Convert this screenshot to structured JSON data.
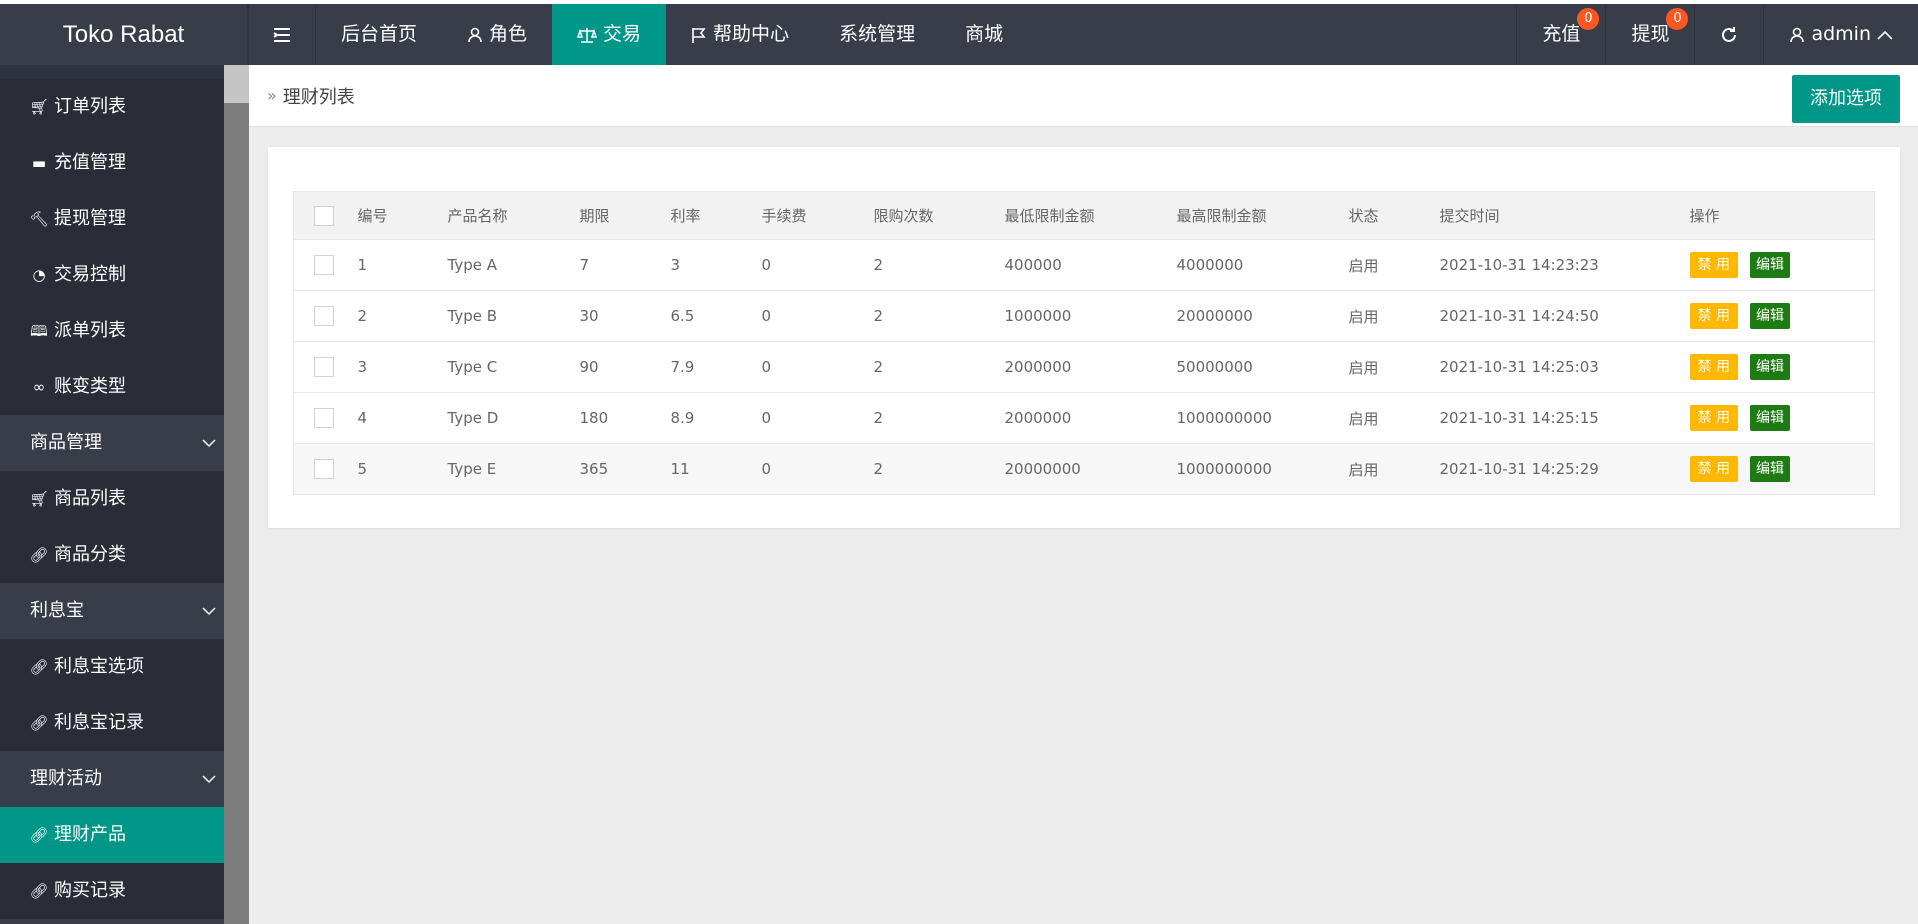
{
  "app": {
    "logo": "Toko Rabat"
  },
  "topnav": {
    "items": [
      {
        "label": "后台首页",
        "icon": "none"
      },
      {
        "label": "角色",
        "icon": "user-icon"
      },
      {
        "label": "交易",
        "icon": "scale-icon",
        "active": true
      },
      {
        "label": "帮助中心",
        "icon": "flag-icon"
      },
      {
        "label": "系统管理",
        "icon": "none"
      },
      {
        "label": "商城",
        "icon": "none"
      }
    ],
    "right": {
      "recharge": {
        "label": "充值",
        "badge": "0"
      },
      "withdraw": {
        "label": "提现",
        "badge": "0"
      },
      "user": {
        "label": "admin"
      }
    }
  },
  "sidebar": {
    "items": [
      {
        "label": "订单列表",
        "icon": "cart-icon"
      },
      {
        "label": "充值管理",
        "icon": "monitor-icon"
      },
      {
        "label": "提现管理",
        "icon": "gavel-icon"
      },
      {
        "label": "交易控制",
        "icon": "dashboard-icon"
      },
      {
        "label": "派单列表",
        "icon": "book-icon"
      },
      {
        "label": "账变类型",
        "icon": "infinity-icon"
      },
      {
        "label": "商品管理",
        "group": true
      },
      {
        "label": "商品列表",
        "icon": "cart-icon"
      },
      {
        "label": "商品分类",
        "icon": "link-icon"
      },
      {
        "label": "利息宝",
        "group": true
      },
      {
        "label": "利息宝选项",
        "icon": "link-icon"
      },
      {
        "label": "利息宝记录",
        "icon": "link-icon"
      },
      {
        "label": "理财活动",
        "group": true
      },
      {
        "label": "理财产品",
        "icon": "link-icon",
        "active": true
      },
      {
        "label": "购买记录",
        "icon": "link-icon"
      }
    ]
  },
  "breadcrumb": {
    "current": "理财列表"
  },
  "toolbar": {
    "add_label": "添加选项"
  },
  "table": {
    "headers": [
      "编号",
      "产品名称",
      "期限",
      "利率",
      "手续费",
      "限购次数",
      "最低限制金额",
      "最高限制金额",
      "状态",
      "提交时间",
      "操作"
    ],
    "rows": [
      [
        "1",
        "Type A",
        "7",
        "3",
        "0",
        "2",
        "400000",
        "4000000",
        "启用",
        "2021-10-31 14:23:23"
      ],
      [
        "2",
        "Type B",
        "30",
        "6.5",
        "0",
        "2",
        "1000000",
        "20000000",
        "启用",
        "2021-10-31 14:24:50"
      ],
      [
        "3",
        "Type C",
        "90",
        "7.9",
        "0",
        "2",
        "2000000",
        "50000000",
        "启用",
        "2021-10-31 14:25:03"
      ],
      [
        "4",
        "Type D",
        "180",
        "8.9",
        "0",
        "2",
        "2000000",
        "1000000000",
        "启用",
        "2021-10-31 14:25:15"
      ],
      [
        "5",
        "Type E",
        "365",
        "11",
        "0",
        "2",
        "20000000",
        "1000000000",
        "启用",
        "2021-10-31 14:25:29"
      ]
    ],
    "actions": {
      "disable": "禁 用",
      "edit": "编辑"
    }
  }
}
